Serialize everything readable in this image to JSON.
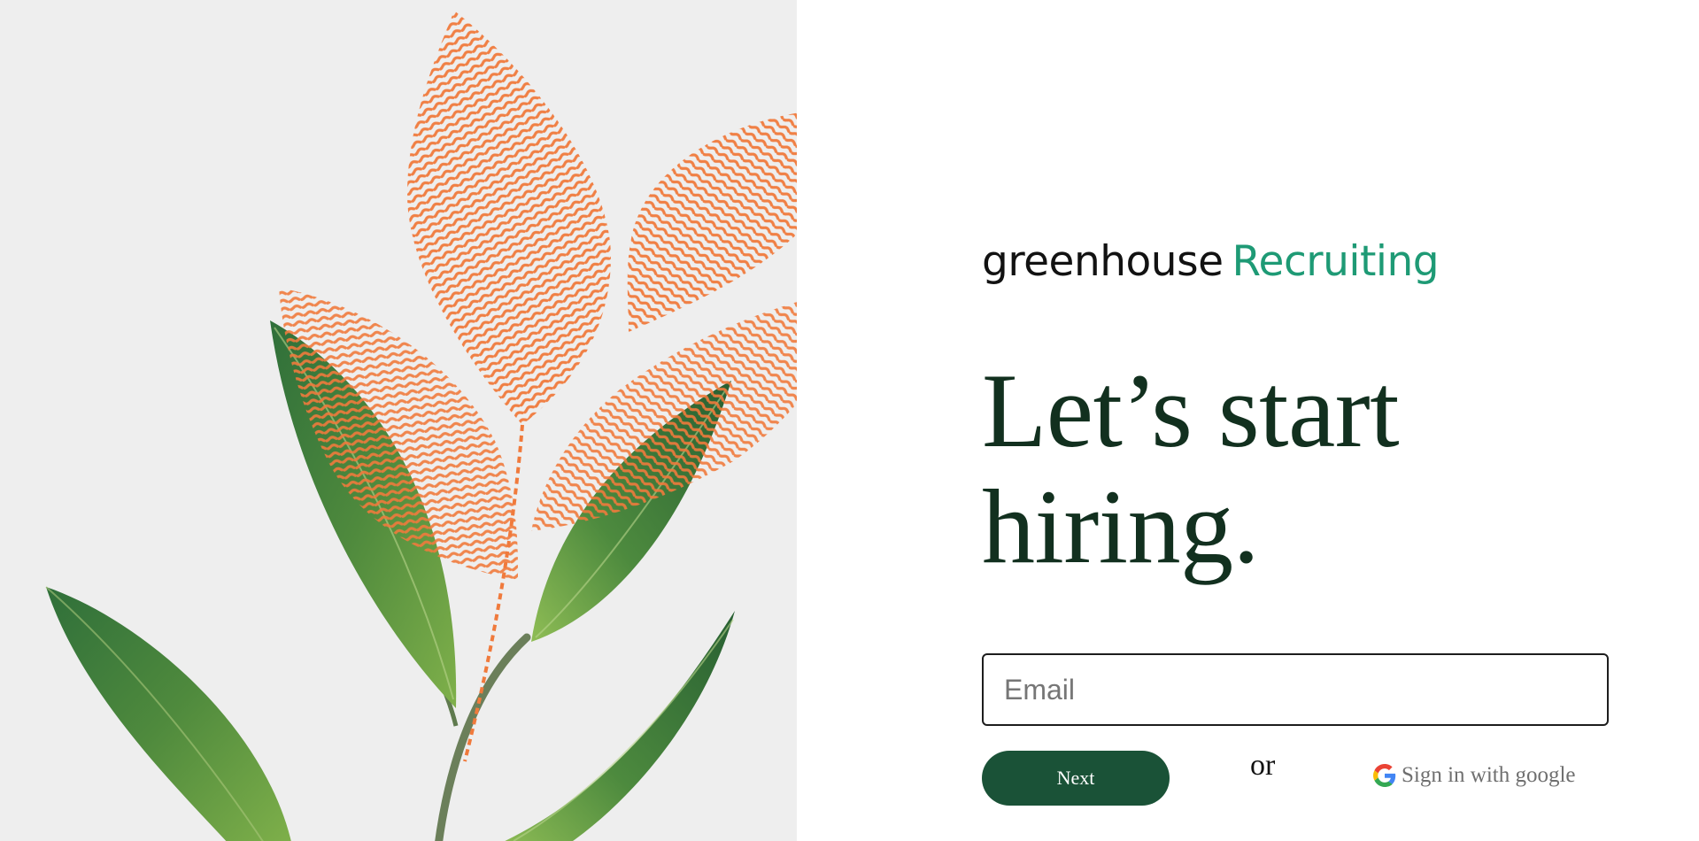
{
  "logo": {
    "word": "greenhouse",
    "product": "Recruiting"
  },
  "headline": {
    "line1": "Let’s start",
    "line2": "hiring."
  },
  "email": {
    "placeholder": "Email",
    "value": ""
  },
  "next_label": "Next",
  "or_label": "or",
  "google": {
    "label": "Sign in with google",
    "icon": "google-g-icon"
  },
  "colors": {
    "brand_green": "#1a5237",
    "logo_teal": "#1e9a75",
    "headline": "#12301f",
    "fingerprint_orange": "#f07a3c",
    "panel_bg": "#eeeeee"
  }
}
